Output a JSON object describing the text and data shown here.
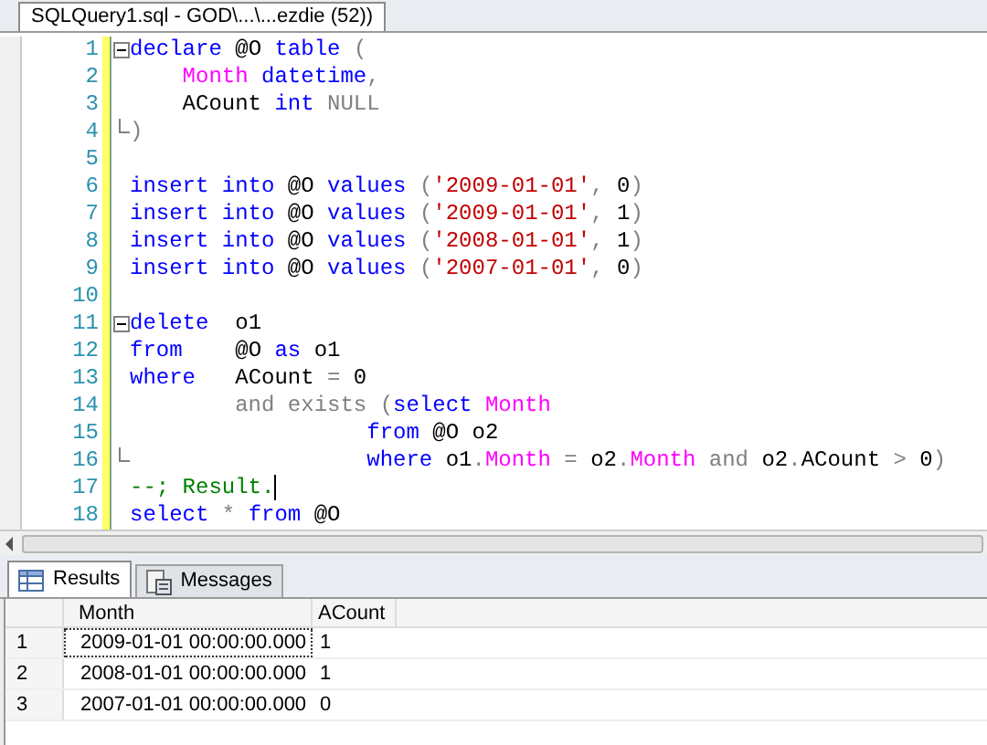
{
  "document_tab": {
    "title": "SQLQuery1.sql - GOD\\...\\...ezdie (52))"
  },
  "editor": {
    "lines": [
      {
        "number": "1",
        "fold_start": true,
        "fold_end": false,
        "tokens": [
          {
            "kind": "keyword",
            "text": "declare"
          },
          {
            "kind": "plain",
            "text": " @O "
          },
          {
            "kind": "keyword",
            "text": "table"
          },
          {
            "kind": "operator",
            "text": " ("
          }
        ]
      },
      {
        "number": "2",
        "fold_start": false,
        "fold_end": false,
        "tokens": [
          {
            "kind": "function",
            "text": "    Month "
          },
          {
            "kind": "keyword",
            "text": "datetime"
          },
          {
            "kind": "operator",
            "text": ","
          }
        ]
      },
      {
        "number": "3",
        "fold_start": false,
        "fold_end": false,
        "tokens": [
          {
            "kind": "plain",
            "text": "    ACount "
          },
          {
            "kind": "keyword",
            "text": "int "
          },
          {
            "kind": "operator",
            "text": "NULL"
          }
        ]
      },
      {
        "number": "4",
        "fold_start": false,
        "fold_end": true,
        "tokens": [
          {
            "kind": "operator",
            "text": ")"
          }
        ]
      },
      {
        "number": "5",
        "fold_start": false,
        "fold_end": false
      },
      {
        "number": "6",
        "fold_start": false,
        "fold_end": false,
        "tokens": [
          {
            "kind": "keyword",
            "text": "insert into"
          },
          {
            "kind": "plain",
            "text": " @O "
          },
          {
            "kind": "keyword",
            "text": "values"
          },
          {
            "kind": "operator",
            "text": " ("
          },
          {
            "kind": "string",
            "text": "'2009-01-01'"
          },
          {
            "kind": "operator",
            "text": ","
          },
          {
            "kind": "plain",
            "text": " 0"
          },
          {
            "kind": "operator",
            "text": ")"
          }
        ]
      },
      {
        "number": "7",
        "fold_start": false,
        "fold_end": false,
        "tokens": [
          {
            "kind": "keyword",
            "text": "insert into"
          },
          {
            "kind": "plain",
            "text": " @O "
          },
          {
            "kind": "keyword",
            "text": "values"
          },
          {
            "kind": "operator",
            "text": " ("
          },
          {
            "kind": "string",
            "text": "'2009-01-01'"
          },
          {
            "kind": "operator",
            "text": ","
          },
          {
            "kind": "plain",
            "text": " 1"
          },
          {
            "kind": "operator",
            "text": ")"
          }
        ]
      },
      {
        "number": "8",
        "fold_start": false,
        "fold_end": false,
        "tokens": [
          {
            "kind": "keyword",
            "text": "insert into"
          },
          {
            "kind": "plain",
            "text": " @O "
          },
          {
            "kind": "keyword",
            "text": "values"
          },
          {
            "kind": "operator",
            "text": " ("
          },
          {
            "kind": "string",
            "text": "'2008-01-01'"
          },
          {
            "kind": "operator",
            "text": ","
          },
          {
            "kind": "plain",
            "text": " 1"
          },
          {
            "kind": "operator",
            "text": ")"
          }
        ]
      },
      {
        "number": "9",
        "fold_start": false,
        "fold_end": false,
        "tokens": [
          {
            "kind": "keyword",
            "text": "insert into"
          },
          {
            "kind": "plain",
            "text": " @O "
          },
          {
            "kind": "keyword",
            "text": "values"
          },
          {
            "kind": "operator",
            "text": " ("
          },
          {
            "kind": "string",
            "text": "'2007-01-01'"
          },
          {
            "kind": "operator",
            "text": ","
          },
          {
            "kind": "plain",
            "text": " 0"
          },
          {
            "kind": "operator",
            "text": ")"
          }
        ]
      },
      {
        "number": "10",
        "fold_start": false,
        "fold_end": false
      },
      {
        "number": "11",
        "fold_start": true,
        "fold_end": false,
        "tokens": [
          {
            "kind": "keyword",
            "text": "delete"
          },
          {
            "kind": "plain",
            "text": "  o1"
          }
        ]
      },
      {
        "number": "12",
        "fold_start": false,
        "fold_end": false,
        "tokens": [
          {
            "kind": "keyword",
            "text": "from"
          },
          {
            "kind": "plain",
            "text": "    @O "
          },
          {
            "kind": "keyword",
            "text": "as"
          },
          {
            "kind": "plain",
            "text": " o1"
          }
        ]
      },
      {
        "number": "13",
        "fold_start": false,
        "fold_end": false,
        "tokens": [
          {
            "kind": "keyword",
            "text": "where"
          },
          {
            "kind": "plain",
            "text": "   ACount "
          },
          {
            "kind": "operator",
            "text": "="
          },
          {
            "kind": "plain",
            "text": " 0"
          }
        ]
      },
      {
        "number": "14",
        "fold_start": false,
        "fold_end": false,
        "tokens": [
          {
            "kind": "operator",
            "text": "        and exists ("
          },
          {
            "kind": "keyword",
            "text": "select "
          },
          {
            "kind": "function",
            "text": "Month"
          }
        ]
      },
      {
        "number": "15",
        "fold_start": false,
        "fold_end": false,
        "tokens": [
          {
            "kind": "keyword",
            "text": "                  from"
          },
          {
            "kind": "plain",
            "text": " @O o2"
          }
        ]
      },
      {
        "number": "16",
        "fold_start": false,
        "fold_end": true,
        "tokens": [
          {
            "kind": "keyword",
            "text": "                  where"
          },
          {
            "kind": "plain",
            "text": " o1"
          },
          {
            "kind": "operator",
            "text": "."
          },
          {
            "kind": "function",
            "text": "Month "
          },
          {
            "kind": "operator",
            "text": "="
          },
          {
            "kind": "plain",
            "text": " o2"
          },
          {
            "kind": "operator",
            "text": "."
          },
          {
            "kind": "function",
            "text": "Month "
          },
          {
            "kind": "operator",
            "text": "and"
          },
          {
            "kind": "plain",
            "text": " o2"
          },
          {
            "kind": "operator",
            "text": "."
          },
          {
            "kind": "plain",
            "text": "ACount "
          },
          {
            "kind": "operator",
            "text": ">"
          },
          {
            "kind": "plain",
            "text": " 0"
          },
          {
            "kind": "operator",
            "text": ")"
          }
        ]
      },
      {
        "number": "17",
        "fold_start": false,
        "fold_end": false,
        "cursor": true,
        "tokens": [
          {
            "kind": "comment",
            "text": "--; Result."
          }
        ]
      },
      {
        "number": "18",
        "fold_start": false,
        "fold_end": false,
        "tokens": [
          {
            "kind": "keyword",
            "text": "select"
          },
          {
            "kind": "operator",
            "text": " * "
          },
          {
            "kind": "keyword",
            "text": "from"
          },
          {
            "kind": "plain",
            "text": " @O"
          }
        ]
      }
    ]
  },
  "result_tabs": [
    {
      "label": "Results",
      "kind": "grid",
      "selected": true
    },
    {
      "label": "Messages",
      "kind": "messages",
      "selected": false
    }
  ],
  "results_grid": {
    "columns": [
      "Month",
      "ACount"
    ],
    "rows": [
      {
        "number": "1",
        "cells": [
          "2009-01-01 00:00:00.000",
          "1"
        ],
        "focused": true
      },
      {
        "number": "2",
        "cells": [
          "2008-01-01 00:00:00.000",
          "1"
        ],
        "focused": false
      },
      {
        "number": "3",
        "cells": [
          "2007-01-01 00:00:00.000",
          "0"
        ],
        "focused": false
      }
    ]
  }
}
